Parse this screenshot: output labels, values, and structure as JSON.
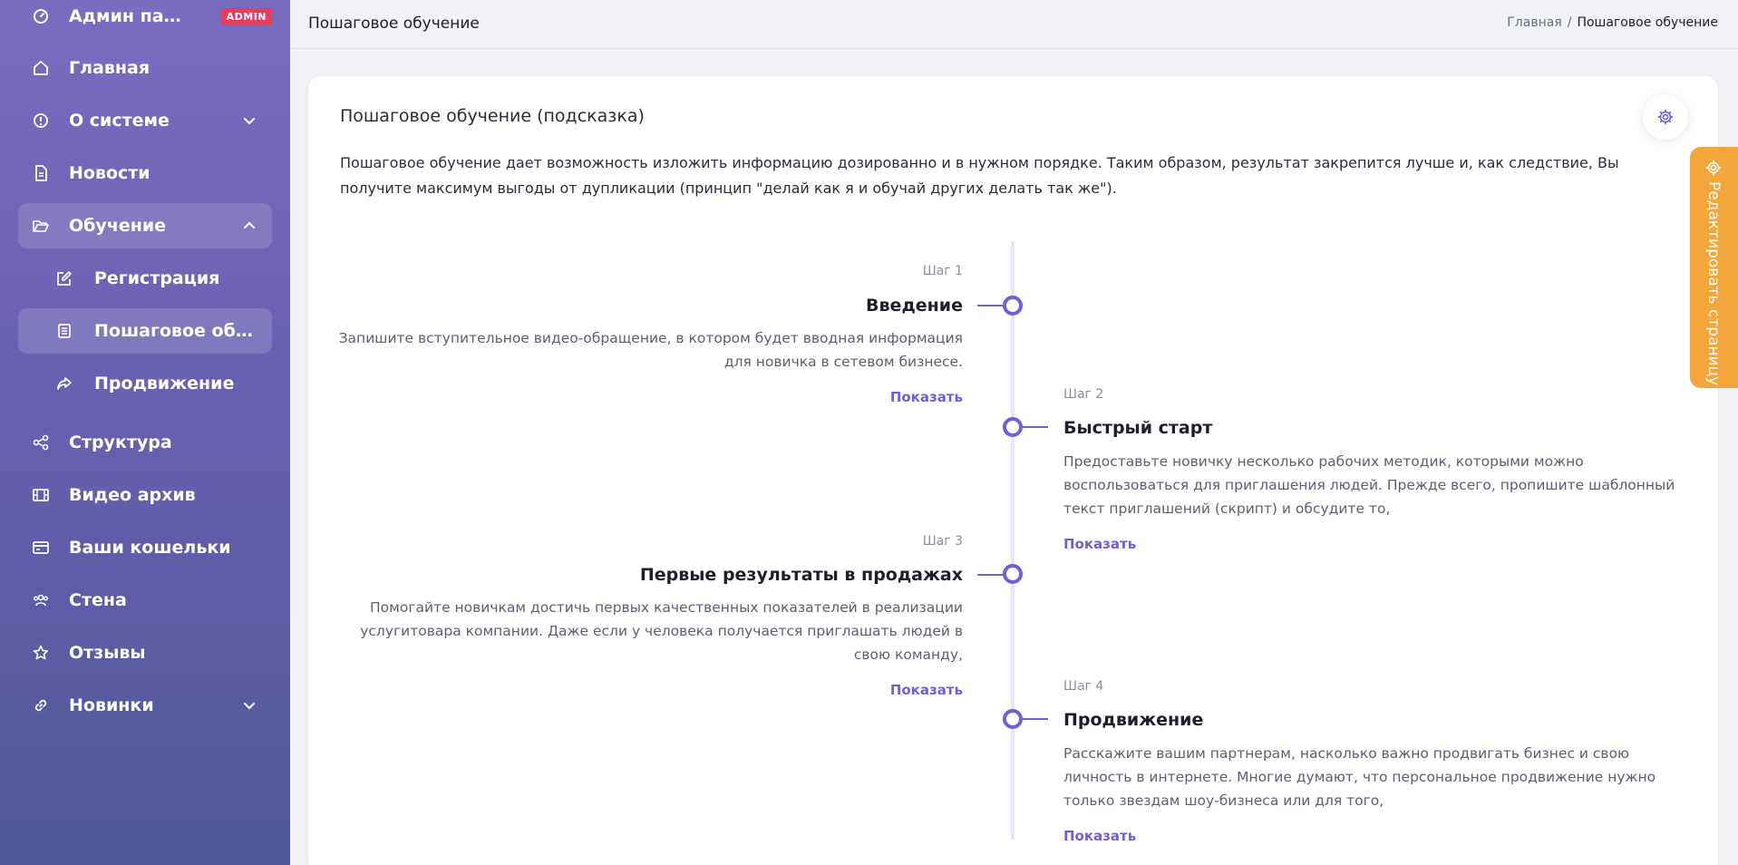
{
  "sidebar": {
    "admin": {
      "label": "Админ панель",
      "badge": "ADMIN"
    },
    "items": [
      {
        "label": "Главная",
        "icon": "home-icon"
      },
      {
        "label": "О системе",
        "icon": "info-icon"
      },
      {
        "label": "Новости",
        "icon": "document-icon"
      },
      {
        "label": "Обучение",
        "icon": "folder-open-icon"
      },
      {
        "label": "Регистрация",
        "icon": "edit-icon"
      },
      {
        "label": "Пошаговое обуч...",
        "icon": "list-icon"
      },
      {
        "label": "Продвижение",
        "icon": "share-icon"
      },
      {
        "label": "Структура",
        "icon": "network-icon"
      },
      {
        "label": "Видео архив",
        "icon": "film-icon"
      },
      {
        "label": "Ваши кошельки",
        "icon": "wallet-icon"
      },
      {
        "label": "Стена",
        "icon": "users-icon"
      },
      {
        "label": "Отзывы",
        "icon": "star-icon"
      },
      {
        "label": "Новинки",
        "icon": "link-icon"
      }
    ]
  },
  "header": {
    "title": "Пошаговое обучение",
    "breadcrumb": {
      "home": "Главная",
      "separator": "/",
      "current": "Пошаговое обучение"
    }
  },
  "card": {
    "title": "Пошаговое обучение (подсказка)",
    "description": "Пошаговое обучение дает возможность изложить информацию дозированно и в нужном порядке. Таким образом, результат закрепится лучше и, как следствие, Вы получите максимум выгоды от дупликации (принцип \"делай как я и обучай других делать так же\")."
  },
  "steps": [
    {
      "num": "Шаг 1",
      "title": "Введение",
      "text": "Запишите вступительное видео-обращение, в котором будет вводная информация для новичка в сетевом бизнесе.",
      "link": "Показать"
    },
    {
      "num": "Шаг 2",
      "title": "Быстрый старт",
      "text": "Предоставьте новичку несколько рабочих методик, которыми можно воспользоваться для приглашения людей. Прежде всего, пропишите шаблонный текст приглашений (скрипт) и обсудите то,",
      "link": "Показать"
    },
    {
      "num": "Шаг 3",
      "title": "Первые результаты в продажах",
      "text": "Помогайте новичкам достичь первых качественных показателей в реализации услугитовара компании. Даже если у человека получается приглашать людей в свою команду,",
      "link": "Показать"
    },
    {
      "num": "Шаг 4",
      "title": "Продвижение",
      "text": "Расскажите вашим партнерам, насколько важно продвигать бизнес и свою личность в интернете. Многие думают, что персональное продвижение нужно только звездам шоу-бизнеса или для того,",
      "link": "Показать"
    }
  ],
  "edit_tab": {
    "label": "Редактировать страницу"
  },
  "colors": {
    "accent": "#6c61d6",
    "badge": "#ea3d5c",
    "edit_tab": "#f5a63a"
  }
}
